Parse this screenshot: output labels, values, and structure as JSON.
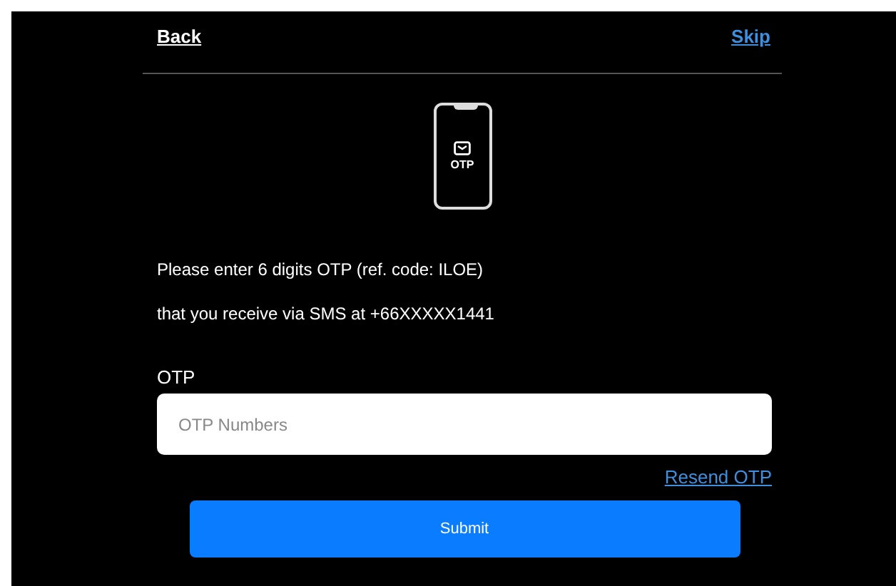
{
  "nav": {
    "back": "Back",
    "skip": "Skip"
  },
  "icon_label": "OTP",
  "instructions": [
    "Please enter 6 digits OTP (ref. code: ILOE)",
    "that you receive via SMS at +66XXXXX1441"
  ],
  "otp_field": {
    "label": "OTP",
    "placeholder": "OTP Numbers"
  },
  "resend": "Resend OTP",
  "submit": "Submit"
}
